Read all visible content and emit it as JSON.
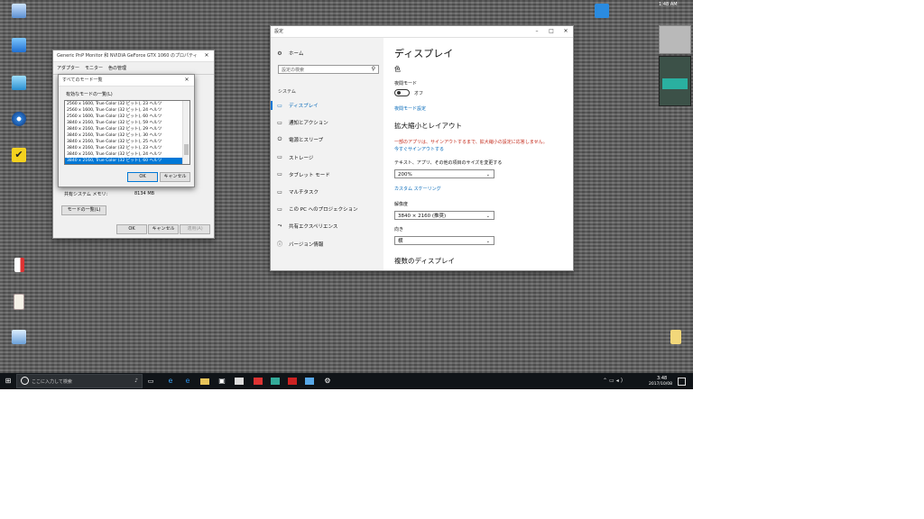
{
  "desktop": {
    "icons_left": [
      {
        "name": "recycle-bin",
        "label": ""
      },
      {
        "name": "network",
        "label": ""
      },
      {
        "name": "control-panel",
        "label": ""
      },
      {
        "name": "remote-app",
        "label": ""
      },
      {
        "name": "app-checked",
        "label": ""
      },
      {
        "name": "document-red",
        "label": ""
      },
      {
        "name": "document-white",
        "label": ""
      },
      {
        "name": "settings-app",
        "label": ""
      }
    ],
    "clock_overlay_time": "1:48 AM"
  },
  "adapter_window": {
    "title": "Generic PnP Monitor 和 NVIDIA GeForce GTX 1060 のプロパティ",
    "tabs": [
      "アダプター",
      "モニター",
      "色の管理"
    ],
    "memory_label": "共有システム メモリ:",
    "memory_value": "8134 MB",
    "list_modes_button": "モードの一覧(L)",
    "ok": "OK",
    "cancel": "キャンセル",
    "apply": "適用(A)"
  },
  "modes_dialog": {
    "title": "すべてのモード一覧",
    "list_label": "有効なモードの一覧(L)",
    "modes": [
      "2560 x 1600, True Color (32 ビット), 23 ヘルツ",
      "2560 x 1600, True Color (32 ビット), 24 ヘルツ",
      "2560 x 1600, True Color (32 ビット), 60 ヘルツ",
      "3840 x 2160, True Color (32 ビット), 59 ヘルツ",
      "3840 x 2160, True Color (32 ビット), 29 ヘルツ",
      "3840 x 2160, True Color (32 ビット), 30 ヘルツ",
      "3840 x 2160, True Color (32 ビット), 25 ヘルツ",
      "3840 x 2160, True Color (32 ビット), 23 ヘルツ",
      "3840 x 2160, True Color (32 ビット), 24 ヘルツ",
      "3840 x 2160, True Color (32 ビット), 60 ヘルツ"
    ],
    "selected_index": 9,
    "ok": "OK",
    "cancel": "キャンセル"
  },
  "settings": {
    "title": "設定",
    "home": "ホーム",
    "search_placeholder": "設定の検索",
    "section": "システム",
    "nav": [
      {
        "label": "ディスプレイ",
        "icon": "display-icon"
      },
      {
        "label": "通知とアクション",
        "icon": "notification-icon"
      },
      {
        "label": "電源とスリープ",
        "icon": "power-icon"
      },
      {
        "label": "ストレージ",
        "icon": "storage-icon"
      },
      {
        "label": "タブレット モード",
        "icon": "tablet-icon"
      },
      {
        "label": "マルチタスク",
        "icon": "multitask-icon"
      },
      {
        "label": "この PC へのプロジェクション",
        "icon": "projection-icon"
      },
      {
        "label": "共有エクスペリエンス",
        "icon": "share-icon"
      },
      {
        "label": "バージョン情報",
        "icon": "info-icon"
      }
    ],
    "page_title": "ディスプレイ",
    "color_heading": "色",
    "night_label": "夜間モード",
    "night_state": "オフ",
    "night_link": "夜間モード設定",
    "scale_heading": "拡大縮小とレイアウト",
    "warning": "一部のアプリは、サインアウトするまで、拡大縮小の設定に応答しません。",
    "signout_link": "今すぐサインアウトする",
    "text_size_label": "テキスト、アプリ、その他の項目のサイズを変更する",
    "text_size_value": "200%",
    "custom_link": "カスタム スケーリング",
    "resolution_label": "解像度",
    "resolution_value": "3840 × 2160 (推奨)",
    "orientation_label": "向き",
    "orientation_value": "横",
    "multi_heading": "複数のディスプレイ"
  },
  "taskbar": {
    "search_placeholder": "ここに入力して検索",
    "time": "3:48",
    "date": "2017/10/08"
  }
}
